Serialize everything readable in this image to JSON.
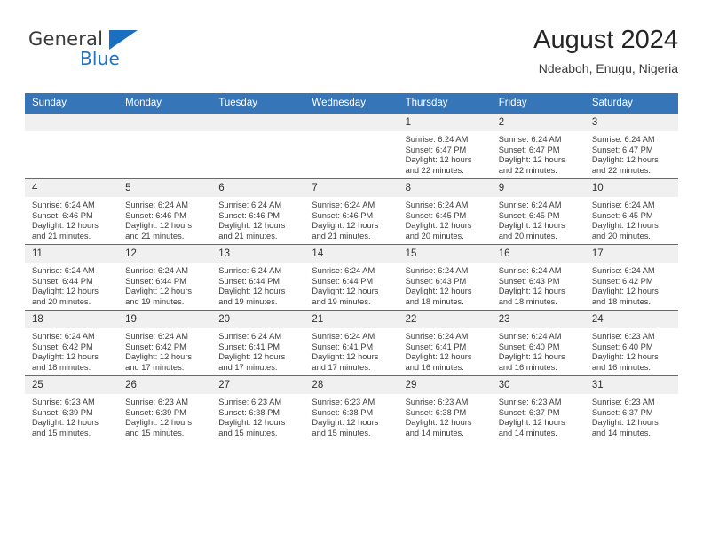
{
  "brand": {
    "name_part1": "General",
    "name_part2": "Blue",
    "logo_icon": "blue-triangle-logo"
  },
  "header": {
    "title": "August 2024",
    "subtitle": "Ndeaboh, Enugu, Nigeria"
  },
  "colors": {
    "header_blue": "#3575b8",
    "brand_blue": "#2275c3",
    "daynum_bg": "#f0f0f0",
    "text": "#3c3c3c"
  },
  "weekday_headers": [
    "Sunday",
    "Monday",
    "Tuesday",
    "Wednesday",
    "Thursday",
    "Friday",
    "Saturday"
  ],
  "weeks": [
    [
      {
        "day": "",
        "empty": true
      },
      {
        "day": "",
        "empty": true
      },
      {
        "day": "",
        "empty": true
      },
      {
        "day": "",
        "empty": true
      },
      {
        "day": "1",
        "sunrise": "Sunrise: 6:24 AM",
        "sunset": "Sunset: 6:47 PM",
        "daylight_line1": "Daylight: 12 hours",
        "daylight_line2": "and 22 minutes."
      },
      {
        "day": "2",
        "sunrise": "Sunrise: 6:24 AM",
        "sunset": "Sunset: 6:47 PM",
        "daylight_line1": "Daylight: 12 hours",
        "daylight_line2": "and 22 minutes."
      },
      {
        "day": "3",
        "sunrise": "Sunrise: 6:24 AM",
        "sunset": "Sunset: 6:47 PM",
        "daylight_line1": "Daylight: 12 hours",
        "daylight_line2": "and 22 minutes."
      }
    ],
    [
      {
        "day": "4",
        "sunrise": "Sunrise: 6:24 AM",
        "sunset": "Sunset: 6:46 PM",
        "daylight_line1": "Daylight: 12 hours",
        "daylight_line2": "and 21 minutes."
      },
      {
        "day": "5",
        "sunrise": "Sunrise: 6:24 AM",
        "sunset": "Sunset: 6:46 PM",
        "daylight_line1": "Daylight: 12 hours",
        "daylight_line2": "and 21 minutes."
      },
      {
        "day": "6",
        "sunrise": "Sunrise: 6:24 AM",
        "sunset": "Sunset: 6:46 PM",
        "daylight_line1": "Daylight: 12 hours",
        "daylight_line2": "and 21 minutes."
      },
      {
        "day": "7",
        "sunrise": "Sunrise: 6:24 AM",
        "sunset": "Sunset: 6:46 PM",
        "daylight_line1": "Daylight: 12 hours",
        "daylight_line2": "and 21 minutes."
      },
      {
        "day": "8",
        "sunrise": "Sunrise: 6:24 AM",
        "sunset": "Sunset: 6:45 PM",
        "daylight_line1": "Daylight: 12 hours",
        "daylight_line2": "and 20 minutes."
      },
      {
        "day": "9",
        "sunrise": "Sunrise: 6:24 AM",
        "sunset": "Sunset: 6:45 PM",
        "daylight_line1": "Daylight: 12 hours",
        "daylight_line2": "and 20 minutes."
      },
      {
        "day": "10",
        "sunrise": "Sunrise: 6:24 AM",
        "sunset": "Sunset: 6:45 PM",
        "daylight_line1": "Daylight: 12 hours",
        "daylight_line2": "and 20 minutes."
      }
    ],
    [
      {
        "day": "11",
        "sunrise": "Sunrise: 6:24 AM",
        "sunset": "Sunset: 6:44 PM",
        "daylight_line1": "Daylight: 12 hours",
        "daylight_line2": "and 20 minutes."
      },
      {
        "day": "12",
        "sunrise": "Sunrise: 6:24 AM",
        "sunset": "Sunset: 6:44 PM",
        "daylight_line1": "Daylight: 12 hours",
        "daylight_line2": "and 19 minutes."
      },
      {
        "day": "13",
        "sunrise": "Sunrise: 6:24 AM",
        "sunset": "Sunset: 6:44 PM",
        "daylight_line1": "Daylight: 12 hours",
        "daylight_line2": "and 19 minutes."
      },
      {
        "day": "14",
        "sunrise": "Sunrise: 6:24 AM",
        "sunset": "Sunset: 6:44 PM",
        "daylight_line1": "Daylight: 12 hours",
        "daylight_line2": "and 19 minutes."
      },
      {
        "day": "15",
        "sunrise": "Sunrise: 6:24 AM",
        "sunset": "Sunset: 6:43 PM",
        "daylight_line1": "Daylight: 12 hours",
        "daylight_line2": "and 18 minutes."
      },
      {
        "day": "16",
        "sunrise": "Sunrise: 6:24 AM",
        "sunset": "Sunset: 6:43 PM",
        "daylight_line1": "Daylight: 12 hours",
        "daylight_line2": "and 18 minutes."
      },
      {
        "day": "17",
        "sunrise": "Sunrise: 6:24 AM",
        "sunset": "Sunset: 6:42 PM",
        "daylight_line1": "Daylight: 12 hours",
        "daylight_line2": "and 18 minutes."
      }
    ],
    [
      {
        "day": "18",
        "sunrise": "Sunrise: 6:24 AM",
        "sunset": "Sunset: 6:42 PM",
        "daylight_line1": "Daylight: 12 hours",
        "daylight_line2": "and 18 minutes."
      },
      {
        "day": "19",
        "sunrise": "Sunrise: 6:24 AM",
        "sunset": "Sunset: 6:42 PM",
        "daylight_line1": "Daylight: 12 hours",
        "daylight_line2": "and 17 minutes."
      },
      {
        "day": "20",
        "sunrise": "Sunrise: 6:24 AM",
        "sunset": "Sunset: 6:41 PM",
        "daylight_line1": "Daylight: 12 hours",
        "daylight_line2": "and 17 minutes."
      },
      {
        "day": "21",
        "sunrise": "Sunrise: 6:24 AM",
        "sunset": "Sunset: 6:41 PM",
        "daylight_line1": "Daylight: 12 hours",
        "daylight_line2": "and 17 minutes."
      },
      {
        "day": "22",
        "sunrise": "Sunrise: 6:24 AM",
        "sunset": "Sunset: 6:41 PM",
        "daylight_line1": "Daylight: 12 hours",
        "daylight_line2": "and 16 minutes."
      },
      {
        "day": "23",
        "sunrise": "Sunrise: 6:24 AM",
        "sunset": "Sunset: 6:40 PM",
        "daylight_line1": "Daylight: 12 hours",
        "daylight_line2": "and 16 minutes."
      },
      {
        "day": "24",
        "sunrise": "Sunrise: 6:23 AM",
        "sunset": "Sunset: 6:40 PM",
        "daylight_line1": "Daylight: 12 hours",
        "daylight_line2": "and 16 minutes."
      }
    ],
    [
      {
        "day": "25",
        "sunrise": "Sunrise: 6:23 AM",
        "sunset": "Sunset: 6:39 PM",
        "daylight_line1": "Daylight: 12 hours",
        "daylight_line2": "and 15 minutes."
      },
      {
        "day": "26",
        "sunrise": "Sunrise: 6:23 AM",
        "sunset": "Sunset: 6:39 PM",
        "daylight_line1": "Daylight: 12 hours",
        "daylight_line2": "and 15 minutes."
      },
      {
        "day": "27",
        "sunrise": "Sunrise: 6:23 AM",
        "sunset": "Sunset: 6:38 PM",
        "daylight_line1": "Daylight: 12 hours",
        "daylight_line2": "and 15 minutes."
      },
      {
        "day": "28",
        "sunrise": "Sunrise: 6:23 AM",
        "sunset": "Sunset: 6:38 PM",
        "daylight_line1": "Daylight: 12 hours",
        "daylight_line2": "and 15 minutes."
      },
      {
        "day": "29",
        "sunrise": "Sunrise: 6:23 AM",
        "sunset": "Sunset: 6:38 PM",
        "daylight_line1": "Daylight: 12 hours",
        "daylight_line2": "and 14 minutes."
      },
      {
        "day": "30",
        "sunrise": "Sunrise: 6:23 AM",
        "sunset": "Sunset: 6:37 PM",
        "daylight_line1": "Daylight: 12 hours",
        "daylight_line2": "and 14 minutes."
      },
      {
        "day": "31",
        "sunrise": "Sunrise: 6:23 AM",
        "sunset": "Sunset: 6:37 PM",
        "daylight_line1": "Daylight: 12 hours",
        "daylight_line2": "and 14 minutes."
      }
    ]
  ]
}
